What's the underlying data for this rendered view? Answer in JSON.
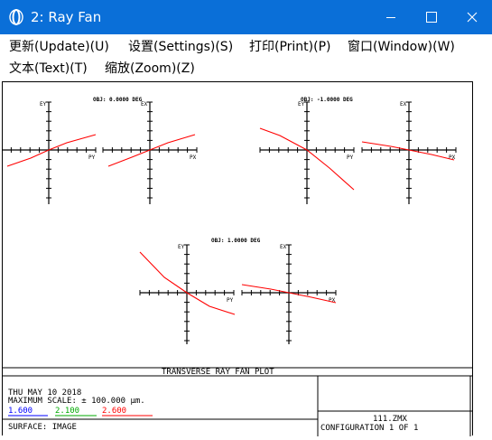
{
  "window": {
    "title": "2: Ray Fan",
    "accent_color": "#0a6fd8",
    "controls": [
      "minimize-icon",
      "maximize-icon",
      "close-icon"
    ]
  },
  "menu": {
    "items": [
      {
        "label": "更新(Update)(U)"
      },
      {
        "label": "设置(Settings)(S)"
      },
      {
        "label": "打印(Print)(P)"
      },
      {
        "label": "窗口(Window)(W)"
      },
      {
        "label": "文本(Text)(T)"
      },
      {
        "label": "缩放(Zoom)(Z)"
      }
    ]
  },
  "plot": {
    "title": "TRANSVERSE RAY FAN PLOT",
    "fields": [
      {
        "label": "OBJ: 0.0000 DEG"
      },
      {
        "label": "OBJ: -1.0000 DEG"
      },
      {
        "label": "OBJ: 1.0000 DEG"
      }
    ],
    "axis_labels": {
      "ey": "EY",
      "ex": "EX",
      "py": "PY",
      "px": "PX"
    },
    "info": {
      "date": "THU MAY 10 2018",
      "max_scale": "MAXIMUM SCALE: ± 100.000 µm.",
      "surface": "SURFACE: IMAGE",
      "file": "111.ZMX",
      "configuration": "CONFIGURATION 1 OF 1"
    },
    "wavelengths": [
      {
        "value": "1.600",
        "color": "#0000ff"
      },
      {
        "value": "2.100",
        "color": "#00aa00"
      },
      {
        "value": "2.600",
        "color": "#ff0000"
      }
    ],
    "curve_color": "#ff0000"
  }
}
